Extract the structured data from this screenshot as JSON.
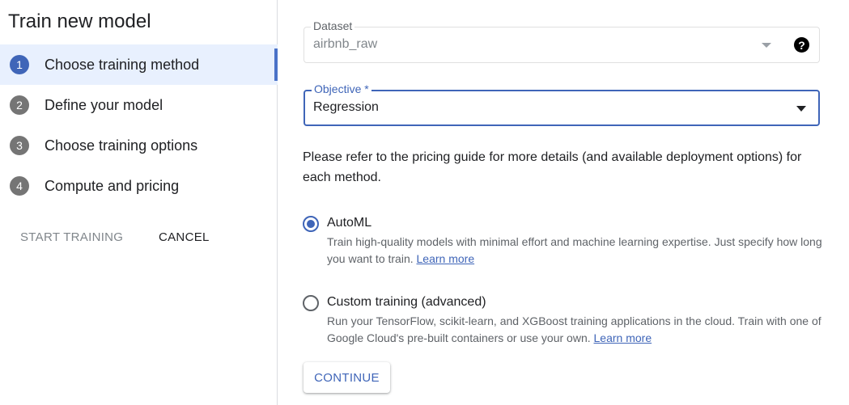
{
  "sidebar": {
    "title": "Train new model",
    "steps": [
      {
        "number": "1",
        "label": "Choose training method",
        "active": true
      },
      {
        "number": "2",
        "label": "Define your model",
        "active": false
      },
      {
        "number": "3",
        "label": "Choose training options",
        "active": false
      },
      {
        "number": "4",
        "label": "Compute and pricing",
        "active": false
      }
    ],
    "start_training_label": "START TRAINING",
    "cancel_label": "CANCEL"
  },
  "form": {
    "dataset": {
      "label": "Dataset",
      "value": "airbnb_raw",
      "help": "?"
    },
    "objective": {
      "label": "Objective *",
      "value": "Regression"
    },
    "info_text": "Please refer to the pricing guide for more details (and available deployment options) for each method.",
    "options": [
      {
        "title": "AutoML",
        "description": "Train high-quality models with minimal effort and machine learning expertise. Just specify how long you want to train.",
        "link": "Learn more",
        "selected": true
      },
      {
        "title": "Custom training (advanced)",
        "description": "Run your TensorFlow, scikit-learn, and XGBoost training applications in the cloud. Train with one of Google Cloud's pre-built containers or use your own.",
        "link": "Learn more",
        "selected": false
      }
    ],
    "continue_label": "CONTINUE"
  },
  "colors": {
    "accent": "#3f65b8",
    "active_step_bg": "#e8f0fe",
    "inactive_step_num": "#757575"
  }
}
